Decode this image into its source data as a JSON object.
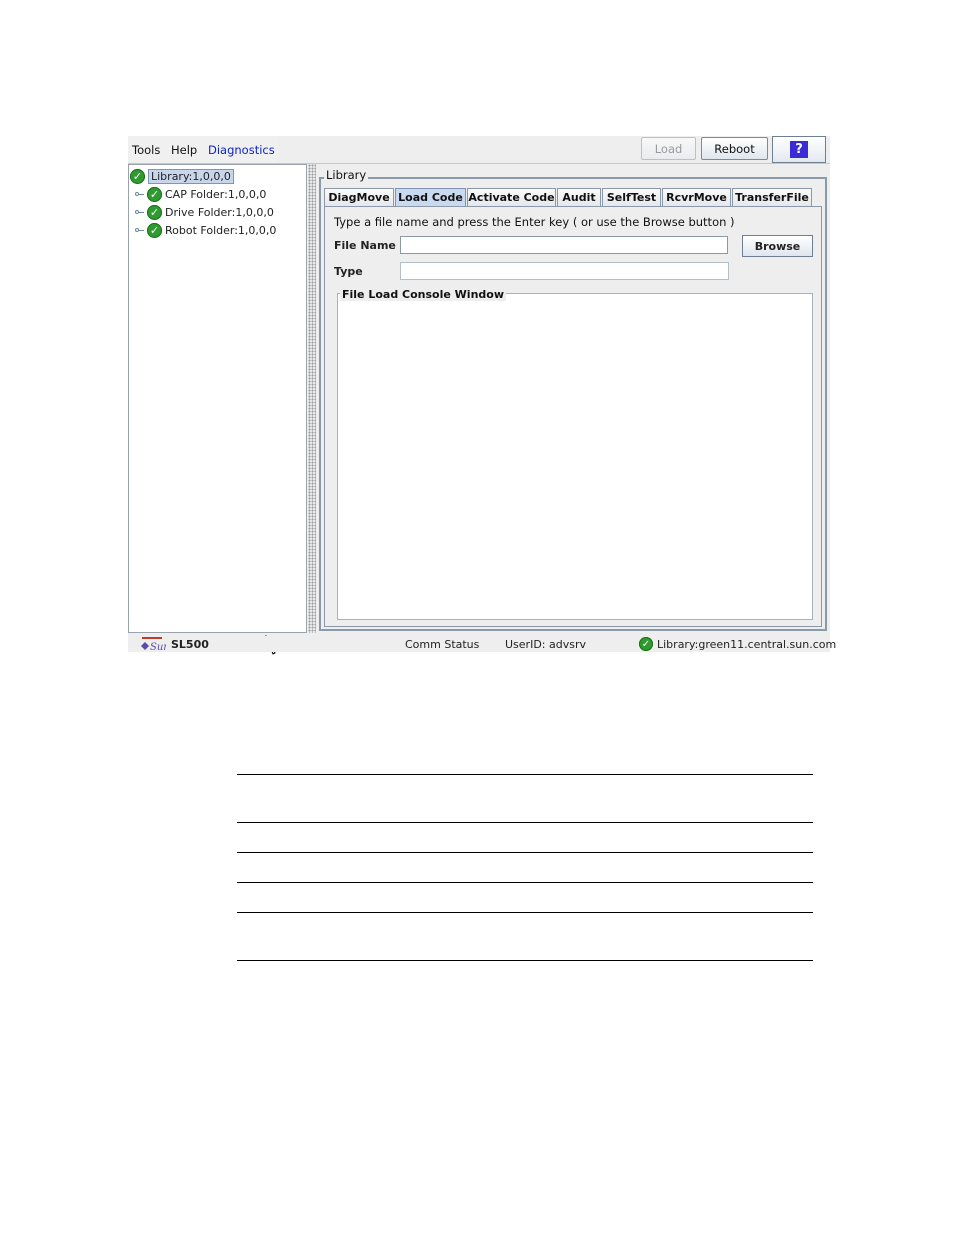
{
  "menu": [
    "Tools",
    "Help",
    "Diagnostics"
  ],
  "toolbar": {
    "load": "Load",
    "reboot": "Reboot",
    "help": "?"
  },
  "tree": {
    "root": "Library:1,0,0,0",
    "children": [
      "CAP Folder:1,0,0,0",
      "Drive Folder:1,0,0,0",
      "Robot Folder:1,0,0,0"
    ]
  },
  "panel": {
    "title": "Library",
    "tabs": [
      "DiagMove",
      "Load Code",
      "Activate Code",
      "Audit",
      "SelfTest",
      "RcvrMove",
      "TransferFile"
    ],
    "active_tab": "Load Code",
    "instruction": "Type a file name and press the Enter key ( or use the Browse button )",
    "file_name_label": "File Name",
    "file_name_value": "",
    "type_label": "Type",
    "type_value": "",
    "browse": "Browse",
    "console_title": "File Load Console Window"
  },
  "status": {
    "product": "SL500",
    "comm": "Comm Status",
    "user": "UserID: advsrv",
    "library": "Library:green11.central.sun.com"
  },
  "colors": {
    "accent": "#0b24c9",
    "ok": "#2f9a2f",
    "active_tab": "#c9daf0"
  }
}
